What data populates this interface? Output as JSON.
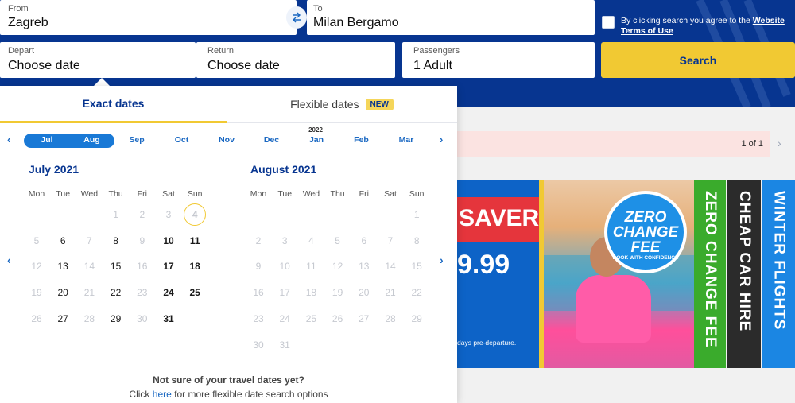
{
  "search": {
    "from": {
      "label": "From",
      "value": "Zagreb"
    },
    "to": {
      "label": "To",
      "value": "Milan Bergamo"
    },
    "depart": {
      "label": "Depart",
      "value": "Choose date"
    },
    "return": {
      "label": "Return",
      "value": "Choose date"
    },
    "passengers": {
      "label": "Passengers",
      "value": "1 Adult"
    },
    "terms_text": "By clicking search you agree to the",
    "terms_link": "Website Terms of Use",
    "search_label": "Search"
  },
  "picker": {
    "tabs": {
      "exact": "Exact dates",
      "flexible": "Flexible dates",
      "new_badge": "NEW"
    },
    "months": [
      "Jul",
      "Aug",
      "Sep",
      "Oct",
      "Nov",
      "Dec",
      "Jan",
      "Feb",
      "Mar"
    ],
    "selected_months": [
      "Jul",
      "Aug"
    ],
    "year_marker": "2022",
    "weekdays": [
      "Mon",
      "Tue",
      "Wed",
      "Thu",
      "Fri",
      "Sat",
      "Sun"
    ],
    "calendars": [
      {
        "title": "July 2021",
        "days": [
          "",
          "",
          "",
          "1",
          "2",
          "3",
          "4",
          "5",
          "6",
          "7",
          "8",
          "9",
          "10",
          "11",
          "12",
          "13",
          "14",
          "15",
          "16",
          "17",
          "18",
          "19",
          "20",
          "21",
          "22",
          "23",
          "24",
          "25",
          "26",
          "27",
          "28",
          "29",
          "30",
          "31"
        ],
        "available": [
          "4",
          "6",
          "8",
          "10",
          "11",
          "13",
          "15",
          "17",
          "18",
          "20",
          "22",
          "24",
          "25",
          "27",
          "29",
          "31"
        ],
        "today": "4"
      },
      {
        "title": "August 2021",
        "days": [
          "",
          "",
          "",
          "",
          "",
          "",
          "1",
          "2",
          "3",
          "4",
          "5",
          "6",
          "7",
          "8",
          "9",
          "10",
          "11",
          "12",
          "13",
          "14",
          "15",
          "16",
          "17",
          "18",
          "19",
          "20",
          "21",
          "22",
          "23",
          "24",
          "25",
          "26",
          "27",
          "28",
          "29",
          "30",
          "31"
        ],
        "available": [],
        "today": ""
      }
    ],
    "footer_question": "Not sure of your travel dates yet?",
    "footer_prefix": "Click",
    "footer_link": "here",
    "footer_suffix": "for more flexible date search options"
  },
  "notice": {
    "pagination": "1 of 1"
  },
  "promo": {
    "savers": "SAVERS",
    "price": "9.99",
    "fine_print": "days pre-departure.",
    "badge_title": "ZERO CHANGE FEE",
    "badge_sub": "BOOK WITH CONFIDENCE",
    "strips": [
      "ZERO CHANGE FEE",
      "CHEAP CAR HIRE",
      "WINTER FLIGHTS"
    ]
  },
  "colors": {
    "brand_blue": "#073590",
    "accent_yellow": "#f1c933",
    "link_blue": "#1a68c2"
  }
}
